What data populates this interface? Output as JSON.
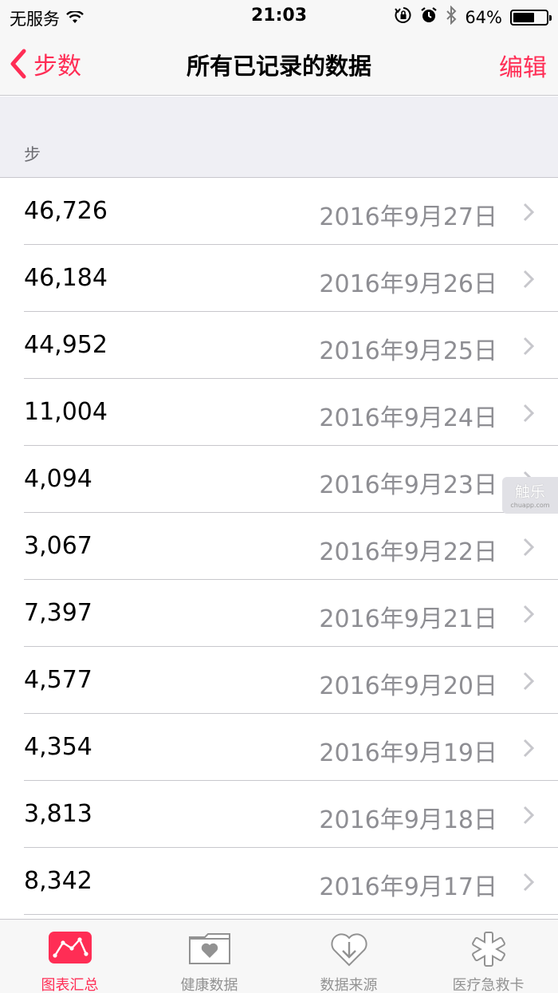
{
  "status_bar": {
    "carrier": "无服务",
    "time": "21:03",
    "battery": "64%",
    "battery_level": 0.64
  },
  "nav": {
    "back_label": "步数",
    "title": "所有已记录的数据",
    "edit_label": "编辑"
  },
  "section": {
    "header": "步"
  },
  "rows": [
    {
      "value": "46,726",
      "date": "2016年9月27日"
    },
    {
      "value": "46,184",
      "date": "2016年9月26日"
    },
    {
      "value": "44,952",
      "date": "2016年9月25日"
    },
    {
      "value": "11,004",
      "date": "2016年9月24日"
    },
    {
      "value": "4,094",
      "date": "2016年9月23日"
    },
    {
      "value": "3,067",
      "date": "2016年9月22日"
    },
    {
      "value": "7,397",
      "date": "2016年9月21日"
    },
    {
      "value": "4,577",
      "date": "2016年9月20日"
    },
    {
      "value": "4,354",
      "date": "2016年9月19日"
    },
    {
      "value": "3,813",
      "date": "2016年9月18日"
    },
    {
      "value": "8,342",
      "date": "2016年9月17日"
    }
  ],
  "watermark": {
    "main": "触乐",
    "sub": "chuapp.com"
  },
  "tabs": [
    {
      "label": "图表汇总",
      "icon": "dashboard-icon",
      "active": true
    },
    {
      "label": "健康数据",
      "icon": "health-data-icon",
      "active": false
    },
    {
      "label": "数据来源",
      "icon": "sources-icon",
      "active": false
    },
    {
      "label": "医疗急救卡",
      "icon": "medical-id-icon",
      "active": false
    }
  ],
  "colors": {
    "accent": "#ff2d55",
    "secondary_text": "#8e8e93",
    "separator": "#c8c7cc",
    "grouped_bg": "#efeff4"
  }
}
